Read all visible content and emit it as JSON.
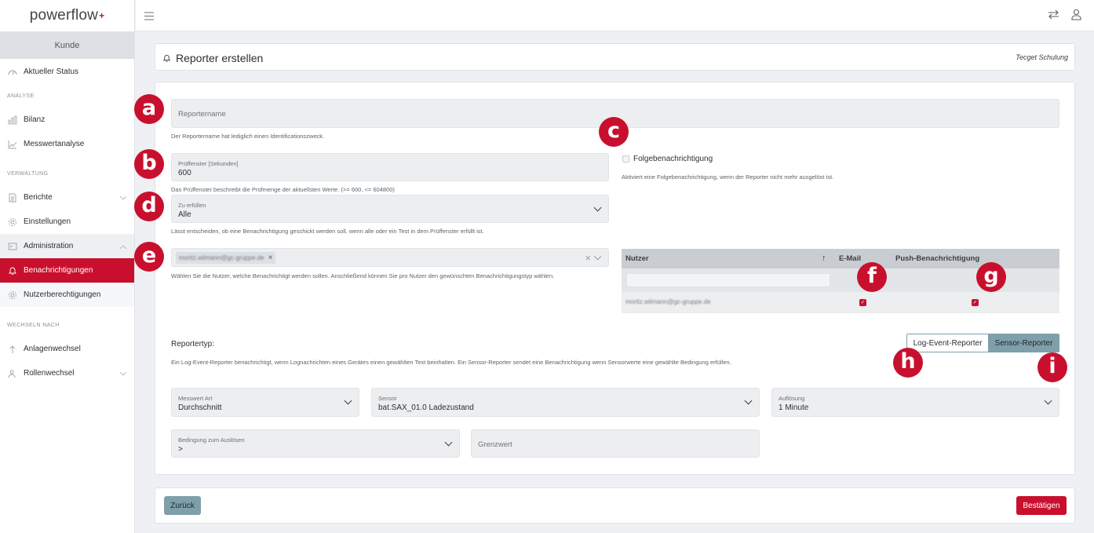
{
  "app": {
    "logo_text": "powerflow",
    "logo_mark": "+"
  },
  "sidebar": {
    "kunde": "Kunde",
    "items": [
      {
        "label": "Aktueller Status",
        "icon": "gauge-icon"
      },
      {
        "label": "ANALYSE"
      },
      {
        "label": "Bilanz",
        "icon": "bar-chart-icon"
      },
      {
        "label": "Messwertanalyse",
        "icon": "line-chart-icon"
      },
      {
        "label": "VERWALTUNG"
      },
      {
        "label": "Berichte",
        "icon": "document-icon"
      },
      {
        "label": "Einstellungen",
        "icon": "gear-icon"
      },
      {
        "label": "Administration",
        "icon": "terminal-icon"
      },
      {
        "label": "Benachrichtigungen",
        "icon": "bell-icon"
      },
      {
        "label": "Nutzerberechtigungen",
        "icon": "gear-icon"
      },
      {
        "label": "WECHSELN NACH"
      },
      {
        "label": "Anlagenwechsel",
        "icon": "arrow-up-icon"
      },
      {
        "label": "Rollenwechsel",
        "icon": "users-icon"
      }
    ]
  },
  "topbar": {
    "menu_icon": "hamburger-icon",
    "swap_icon": "swap-icon",
    "user_icon": "user-icon"
  },
  "header": {
    "title": "Reporter erstellen",
    "org": "Tecget Schulung",
    "icon": "bell-icon"
  },
  "form": {
    "reportername": {
      "placeholder": "Reportername",
      "help": "Der Reportername hat lediglich einen Identificationszweck."
    },
    "pruefenster": {
      "label": "Prüffenster [Sekunden]",
      "value": "600",
      "help": "Das Prüffenster beschreibt die Prüfmenge der aktuellsten Werte. (>= 600, <= 604800)"
    },
    "folge": {
      "label": "Folgebenachrichtigung",
      "help": "Aktiviert eine Folgebenachrichtigung, wenn der Reporter nicht mehr ausgelöst ist."
    },
    "zu_erfuellen": {
      "label": "Zu erfüllen",
      "value": "Alle",
      "help": "Lässt entscheiden, ob eine Benachrichtigung geschickt werden soll, wenn alle oder ein Test in dem Prüffenster erfüllt ist."
    },
    "nutzer_select": {
      "tag": "moritz.wilmann@gc-gruppe.de",
      "help": "Wählen Sie die Nutzer, welche Benachrichtigt werden sollen. Anschließend können Sie pro Nutzer den gewünschten Benachrichtigungstyp wählen."
    },
    "table": {
      "headers": [
        "Nutzer",
        "E-Mail",
        "Push-Benachrichtigung"
      ],
      "sort_icon": "↑",
      "rows": [
        {
          "user": "moritz.wilmann@gc-gruppe.de",
          "email": true,
          "push": true
        }
      ]
    },
    "reportertyp": {
      "label": "Reportertyp:",
      "help": "Ein Log-Event-Reporter benachrichtigt, wenn Lognachrichten eines Gerätes einen gewählten Text beinhalten. Ein Sensor-Reporter sendet eine Benachrichtigung wenn Sensorwerte eine gewählte Bedingung erfüllen.",
      "options": [
        "Log-Event-Reporter",
        "Sensor-Reporter"
      ],
      "selected": "Sensor-Reporter"
    },
    "messwert_art": {
      "label": "Messwert Art",
      "value": "Durchschnitt"
    },
    "sensor": {
      "label": "Sensor",
      "value": "bat.SAX_01.0 Ladezustand"
    },
    "aufloesung": {
      "label": "Auflösung",
      "value": "1 Minute"
    },
    "bedingung": {
      "label": "Bedingung zum Auslösen",
      "value": ">"
    },
    "grenzwert": {
      "placeholder": "Grenzwert"
    }
  },
  "footer": {
    "back": "Zurück",
    "confirm": "Bestätigen"
  },
  "annotations": [
    "a",
    "b",
    "c",
    "d",
    "e",
    "f",
    "g",
    "h",
    "i"
  ],
  "colors": {
    "accent": "#c8102e",
    "muted_button": "#7fa0aa",
    "field_bg": "#eceef0"
  }
}
